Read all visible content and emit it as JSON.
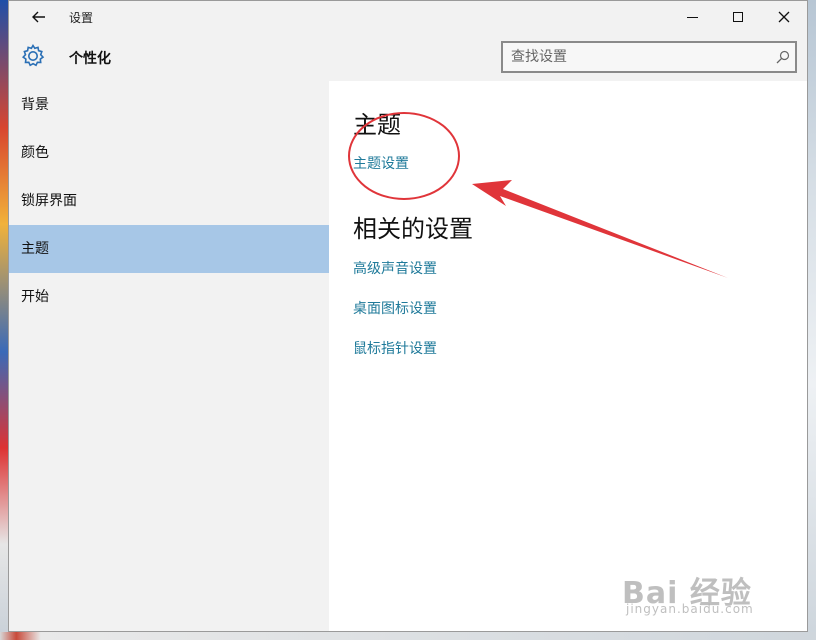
{
  "window": {
    "title": "设置",
    "back_icon": "back-arrow-icon"
  },
  "header": {
    "icon": "gear-icon",
    "page_title": "个性化",
    "search_placeholder": "查找设置"
  },
  "sidebar": {
    "items": [
      {
        "label": "背景",
        "selected": false
      },
      {
        "label": "颜色",
        "selected": false
      },
      {
        "label": "锁屏界面",
        "selected": false
      },
      {
        "label": "主题",
        "selected": true
      },
      {
        "label": "开始",
        "selected": false
      }
    ],
    "selected_color": "#a7c7e7"
  },
  "main": {
    "theme_heading": "主题",
    "theme_settings_link": "主题设置",
    "related_heading": "相关的设置",
    "related_links": [
      "高级声音设置",
      "桌面图标设置",
      "鼠标指针设置"
    ],
    "link_color": "#1f7a9a"
  },
  "watermark": {
    "main": "Bai 经验",
    "sub": "jingyan.baidu.com"
  },
  "annotation": {
    "color": "#e0353a"
  }
}
